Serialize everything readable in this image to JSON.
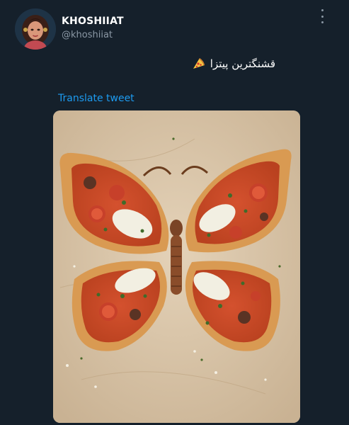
{
  "author": {
    "display_name": "KHOSHIIAT",
    "handle": "@khoshiiat",
    "avatar_icon": "avatar-illustration"
  },
  "menu": {
    "icon": "more-vertical-icon"
  },
  "tweet": {
    "text": "قشنگترین پیتزا",
    "emoji_icon": "pizza-slice-icon"
  },
  "translate": {
    "label": "Translate tweet"
  },
  "media": {
    "subject": "butterfly-shaped-pizza"
  },
  "colors": {
    "background": "#15202b",
    "link": "#1d9bf0",
    "secondary_text": "#8b98a5"
  }
}
